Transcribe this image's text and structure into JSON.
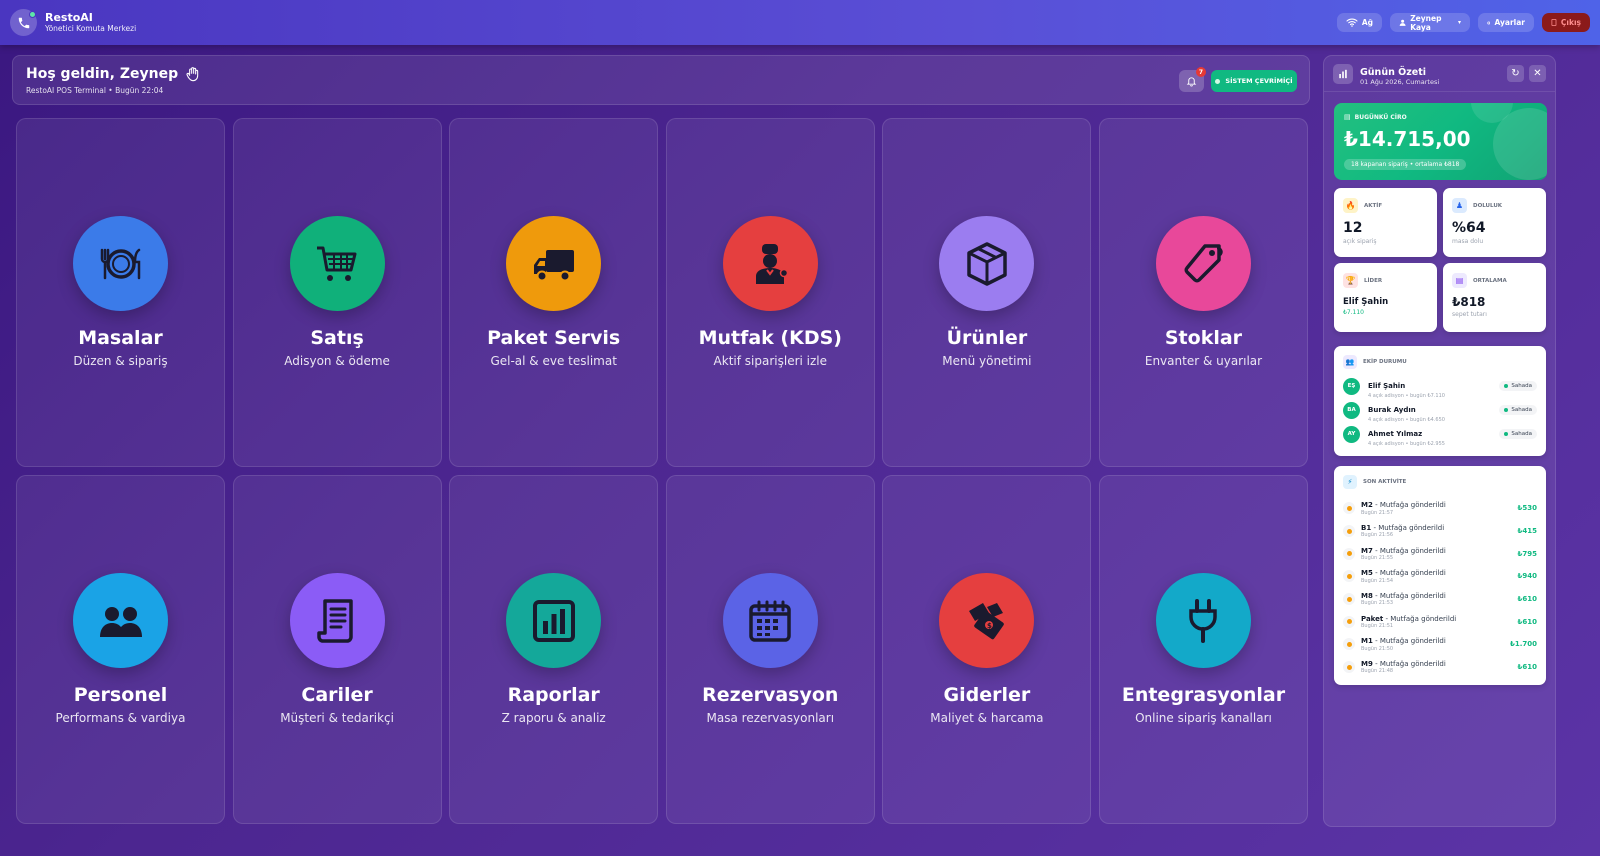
{
  "app": {
    "name": "RestoAI",
    "subtitle": "Yönetici Komuta Merkezi"
  },
  "topbar": {
    "network_label": "Ağ",
    "user_label": "Zeynep Kaya",
    "settings_label": "Ayarlar",
    "exit_label": "Çıkış"
  },
  "welcome": {
    "title": "Hoş geldin, Zeynep",
    "subtitle": "RestoAI POS Terminal • Bugün 22:04",
    "notification_count": "7",
    "status_label": "SİSTEM ÇEVRİMİÇİ"
  },
  "tiles": [
    {
      "title": "Masalar",
      "subtitle": "Düzen & sipariş",
      "icon": "plate-icon",
      "color": "#3b7be9"
    },
    {
      "title": "Satış",
      "subtitle": "Adisyon & ödeme",
      "icon": "cart-icon",
      "color": "#10b07a"
    },
    {
      "title": "Paket Servis",
      "subtitle": "Gel-al & eve teslimat",
      "icon": "truck-icon",
      "color": "#ef9a0c"
    },
    {
      "title": "Mutfak (KDS)",
      "subtitle": "Aktif siparişleri izle",
      "icon": "chef-icon",
      "color": "#e53f3f"
    },
    {
      "title": "Ürünler",
      "subtitle": "Menü yönetimi",
      "icon": "box-icon",
      "color": "#9b7df0"
    },
    {
      "title": "Stoklar",
      "subtitle": "Envanter & uyarılar",
      "icon": "tag-icon",
      "color": "#e8489a"
    },
    {
      "title": "Personel",
      "subtitle": "Performans & vardiya",
      "icon": "people-icon",
      "color": "#1aa3e6"
    },
    {
      "title": "Cariler",
      "subtitle": "Müşteri & tedarikçi",
      "icon": "receipt-icon",
      "color": "#8b5cf6"
    },
    {
      "title": "Raporlar",
      "subtitle": "Z raporu & analiz",
      "icon": "chart-icon",
      "color": "#14a89a"
    },
    {
      "title": "Rezervasyon",
      "subtitle": "Masa rezervasyonları",
      "icon": "calendar-icon",
      "color": "#5b63e6"
    },
    {
      "title": "Giderler",
      "subtitle": "Maliyet & harcama",
      "icon": "money-icon",
      "color": "#e53f3f"
    },
    {
      "title": "Entegrasyonlar",
      "subtitle": "Online sipariş kanalları",
      "icon": "plug-icon",
      "color": "#13a9c9"
    }
  ],
  "summary": {
    "title": "Günün Özeti",
    "date": "01 Ağu 2026, Cumartesi",
    "revenue": {
      "label": "BUGÜNKÜ CİRO",
      "value": "₺14.715,00",
      "note": "18 kapanan sipariş • ortalama ₺818"
    },
    "kpis": [
      {
        "label": "AKTİF",
        "value": "12",
        "sub": "açık sipariş",
        "icon": "fire-icon",
        "icon_bg": "#fef3c7"
      },
      {
        "label": "DOLULUK",
        "value": "%64",
        "sub": "masa dolu",
        "icon": "seat-icon",
        "icon_bg": "#dbeafe"
      },
      {
        "label": "LİDER",
        "value": "Elif Şahin",
        "sub": "₺7.110",
        "icon": "trophy-icon",
        "icon_bg": "#fee2e2"
      },
      {
        "label": "ORTALAMA",
        "value": "₺818",
        "sub": "sepet tutarı",
        "icon": "receipt-icon",
        "icon_bg": "#ede9fe"
      }
    ],
    "team": {
      "label": "EKİP DURUMU",
      "members": [
        {
          "initials": "EŞ",
          "name": "Elif Şahin",
          "detail": "4 açık adisyon • bugün ₺7.110",
          "status": "Sahada"
        },
        {
          "initials": "BA",
          "name": "Burak Aydın",
          "detail": "4 açık adisyon • bugün ₺4.650",
          "status": "Sahada"
        },
        {
          "initials": "AY",
          "name": "Ahmet Yılmaz",
          "detail": "4 açık adisyon • bugün ₺2.955",
          "status": "Sahada"
        }
      ]
    },
    "activity": {
      "label": "SON AKTİVİTE",
      "items": [
        {
          "code": "M2",
          "text": " - Mutfağa gönderildi",
          "time": "Bugün 21:57",
          "amount": "₺530"
        },
        {
          "code": "B1",
          "text": " - Mutfağa gönderildi",
          "time": "Bugün 21:56",
          "amount": "₺415"
        },
        {
          "code": "M7",
          "text": " - Mutfağa gönderildi",
          "time": "Bugün 21:55",
          "amount": "₺795"
        },
        {
          "code": "M5",
          "text": " - Mutfağa gönderildi",
          "time": "Bugün 21:54",
          "amount": "₺940"
        },
        {
          "code": "M8",
          "text": " - Mutfağa gönderildi",
          "time": "Bugün 21:53",
          "amount": "₺610"
        },
        {
          "code": "Paket",
          "text": " - Mutfağa gönderildi",
          "time": "Bugün 21:51",
          "amount": "₺610"
        },
        {
          "code": "M1",
          "text": " - Mutfağa gönderildi",
          "time": "Bugün 21:50",
          "amount": "₺1.700"
        },
        {
          "code": "M9",
          "text": " - Mutfağa gönderildi",
          "time": "Bugün 21:48",
          "amount": "₺610"
        }
      ]
    }
  }
}
